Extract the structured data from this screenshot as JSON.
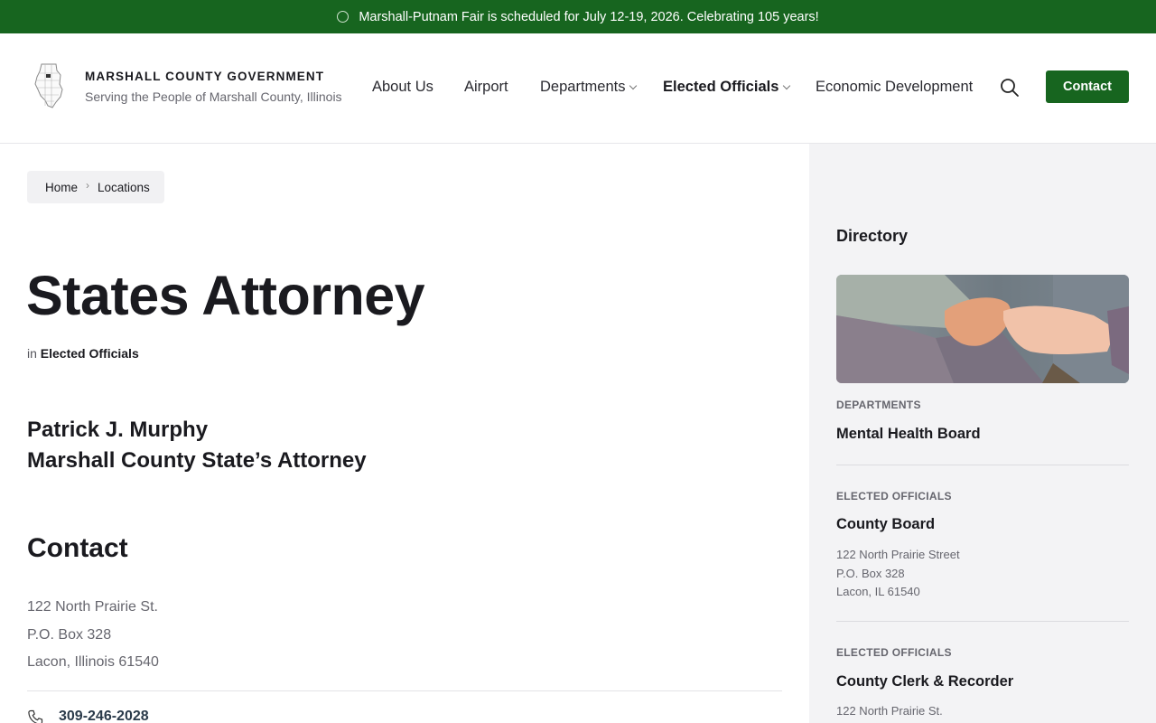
{
  "announcement": {
    "text": "Marshall-Putnam Fair is scheduled for July 12-19, 2026. Celebrating 105 years!"
  },
  "header": {
    "brand_title": "MARSHALL COUNTY GOVERNMENT",
    "brand_subtitle": "Serving the People of Marshall County, Illinois",
    "nav": [
      {
        "label": "About Us"
      },
      {
        "label": "Airport"
      },
      {
        "label": "Departments"
      },
      {
        "label": "Elected Officials"
      },
      {
        "label": "Economic Development"
      }
    ],
    "search_icon": "search-icon",
    "contact_label": "Contact"
  },
  "breadcrumb": {
    "items": [
      "Home",
      "Locations"
    ],
    "separator": "›"
  },
  "main": {
    "title": "States Attorney",
    "category_prefix": "in",
    "category": "Elected Officials",
    "person_name": "Patrick J. Murphy",
    "person_role": "Marshall County State’s Attorney",
    "contact_heading": "Contact",
    "address_lines": [
      "122 North Prairie St.",
      "P.O. Box 328",
      "Lacon, Illinois 61540"
    ],
    "phone": "309-246-2028",
    "phone_icon": "phone-icon"
  },
  "sidebar": {
    "title": "Directory",
    "entries": [
      {
        "category": "DEPARTMENTS",
        "name": "Mental Health Board",
        "address": []
      },
      {
        "category": "ELECTED OFFICIALS",
        "name": "County Board",
        "address": [
          "122 North Prairie Street",
          "P.O. Box 328",
          "Lacon, IL 61540"
        ]
      },
      {
        "category": "ELECTED OFFICIALS",
        "name": "County Clerk & Recorder",
        "address": [
          "122 North Prairie St."
        ]
      }
    ]
  },
  "colors": {
    "brand_green": "#17651f",
    "sidebar_bg": "#f3f3f5",
    "text_dark": "#1a1a1f",
    "text_muted": "#66666e"
  }
}
